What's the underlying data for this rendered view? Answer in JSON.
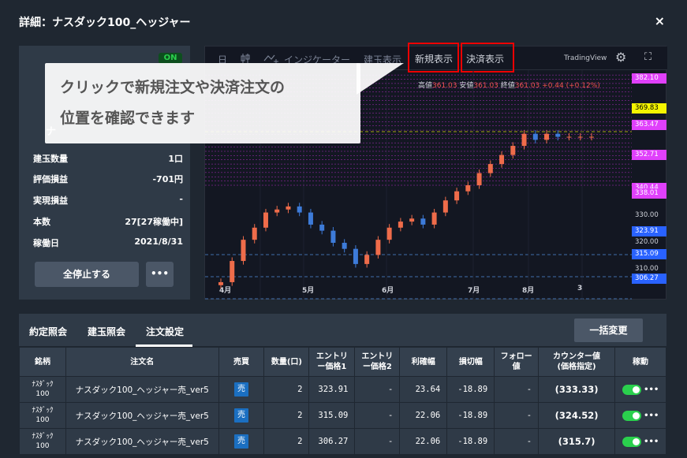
{
  "window": {
    "title": "詳細：ナスダック100_ヘッジャー",
    "close": "×"
  },
  "summary": {
    "status": "ON",
    "name": "ナ",
    "stats": [
      {
        "label": "建玉数量",
        "value": "1口"
      },
      {
        "label": "評価損益",
        "value": "-701円"
      },
      {
        "label": "実現損益",
        "value": "-"
      },
      {
        "label": "本数",
        "value": "27[27稼働中]"
      },
      {
        "label": "稼働日",
        "value": "2021/8/31"
      }
    ],
    "stop_all": "全停止する",
    "more": "•••"
  },
  "chart_toolbar": {
    "interval": "日",
    "candle_icon": "candlestick-icon",
    "indicator": "インジケーター",
    "positions": "建玉表示",
    "new_display": "新規表示",
    "settle_display": "決済表示",
    "brand": "TradingView"
  },
  "chart_info": {
    "high_label": "高値",
    "high": "361.03",
    "low_label": "安値",
    "low": "361.03",
    "close_label": "終値",
    "close": "361.03",
    "change": "+0.44 (+0.12%)"
  },
  "callout": {
    "line1": "クリックで新規注文や決済注文の",
    "line2": "位置を確認できます"
  },
  "chart_data": {
    "type": "candlestick",
    "x_labels": [
      "4月",
      "5月",
      "6月",
      "7月",
      "8月",
      "3"
    ],
    "ylim": [
      307,
      383
    ],
    "price_axis": [
      "382.10",
      "369.83",
      "363.47",
      "352.71",
      "340.44",
      "338.01",
      "330.00",
      "323.91",
      "320.00",
      "315.09",
      "310.00",
      "306.27"
    ],
    "closes": [
      313,
      320,
      327,
      331,
      336,
      337,
      338,
      336,
      332,
      330,
      326,
      324,
      319,
      322,
      327,
      331,
      333,
      334,
      332,
      336,
      340,
      343,
      345,
      349,
      352,
      355,
      358,
      362,
      360,
      362,
      361,
      361,
      361,
      361
    ]
  },
  "tabs": [
    {
      "label": "約定照会"
    },
    {
      "label": "建玉照会"
    },
    {
      "label": "注文設定"
    }
  ],
  "bulk_change": "一括変更",
  "table": {
    "headers": [
      "銘柄",
      "注文名",
      "売買",
      "数量(口)",
      "エントリー価格1",
      "エントリー価格2",
      "利確幅",
      "損切幅",
      "フォロー値",
      "カウンター値(価格指定)",
      "稼動"
    ],
    "header_lines": [
      [
        "銘柄"
      ],
      [
        "注文名"
      ],
      [
        "売買"
      ],
      [
        "数量(口)"
      ],
      [
        "エントリ",
        "ー価格1"
      ],
      [
        "エントリ",
        "ー価格2"
      ],
      [
        "利確幅"
      ],
      [
        "損切幅"
      ],
      [
        "フォロー",
        "値"
      ],
      [
        "カウンター値",
        "(価格指定)"
      ],
      [
        "稼動"
      ]
    ],
    "rows": [
      {
        "symbol_1": "ﾅｽﾀﾞｯｸ",
        "symbol_2": "100",
        "name": "ナスダック100_ヘッジャー売_ver5",
        "side": "売",
        "qty": "2",
        "entry1": "323.91",
        "entry2": "-",
        "tp": "23.64",
        "sl": "-18.89",
        "follow": "-",
        "counter": "(333.33)",
        "more": "•••"
      },
      {
        "symbol_1": "ﾅｽﾀﾞｯｸ",
        "symbol_2": "100",
        "name": "ナスダック100_ヘッジャー売_ver5",
        "side": "売",
        "qty": "2",
        "entry1": "315.09",
        "entry2": "-",
        "tp": "22.06",
        "sl": "-18.89",
        "follow": "-",
        "counter": "(324.52)",
        "more": "•••"
      },
      {
        "symbol_1": "ﾅｽﾀﾞｯｸ",
        "symbol_2": "100",
        "name": "ナスダック100_ヘッジャー売_ver5",
        "side": "売",
        "qty": "2",
        "entry1": "306.27",
        "entry2": "-",
        "tp": "22.06",
        "sl": "-18.89",
        "follow": "-",
        "counter": "(315.7)",
        "more": "•••"
      }
    ]
  }
}
